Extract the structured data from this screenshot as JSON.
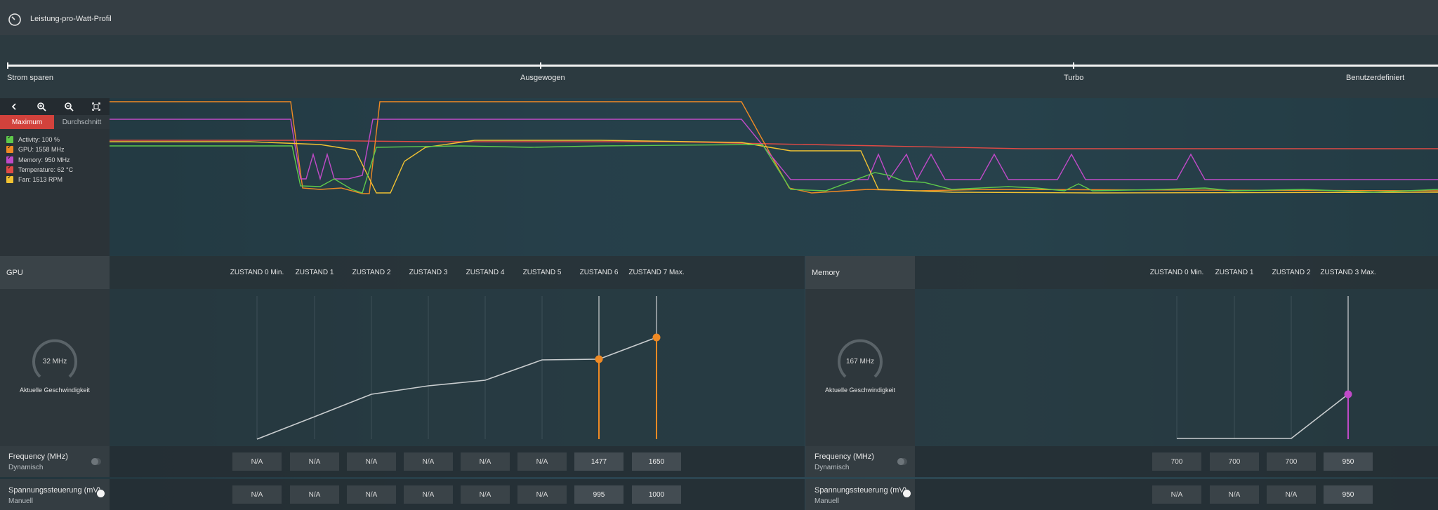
{
  "app": {
    "title": "Leistung-pro-Watt-Profil"
  },
  "profile_slider": {
    "options": [
      "Strom sparen",
      "Ausgewogen",
      "Turbo",
      "Benutzerdefiniert"
    ]
  },
  "graph": {
    "buttons": {
      "maximum": "Maximum",
      "average": "Durchschnitt"
    },
    "legend": [
      {
        "label": "Activity: 100 %",
        "color": "#5ec94b"
      },
      {
        "label": "GPU: 1558 MHz",
        "color": "#f08a24"
      },
      {
        "label": "Memory: 950 MHz",
        "color": "#c04ac8"
      },
      {
        "label": "Temperature: 62 °C",
        "color": "#e04a45"
      },
      {
        "label": "Fan: 1513 RPM",
        "color": "#f1c232"
      }
    ]
  },
  "gpu": {
    "title": "GPU",
    "states": [
      "ZUSTAND 0 Min.",
      "ZUSTAND 1",
      "ZUSTAND 2",
      "ZUSTAND 3",
      "ZUSTAND 4",
      "ZUSTAND 5",
      "ZUSTAND 6",
      "ZUSTAND 7 Max."
    ],
    "current_speed": "32 MHz",
    "current_speed_label": "Aktuelle Geschwindigkeit",
    "frequency": {
      "label": "Frequency (MHz)",
      "mode": "Dynamisch",
      "values": [
        "N/A",
        "N/A",
        "N/A",
        "N/A",
        "N/A",
        "N/A",
        "1477",
        "1650"
      ]
    },
    "voltage": {
      "label": "Spannungssteuerung (mV)",
      "mode": "Manuell",
      "values": [
        "N/A",
        "N/A",
        "N/A",
        "N/A",
        "N/A",
        "N/A",
        "995",
        "1000"
      ]
    }
  },
  "memory": {
    "title": "Memory",
    "states": [
      "ZUSTAND 0 Min.",
      "ZUSTAND 1",
      "ZUSTAND 2",
      "ZUSTAND 3 Max."
    ],
    "current_speed": "167 MHz",
    "current_speed_label": "Aktuelle Geschwindigkeit",
    "frequency": {
      "label": "Frequency (MHz)",
      "mode": "Dynamisch",
      "values": [
        "700",
        "700",
        "700",
        "950"
      ]
    },
    "voltage": {
      "label": "Spannungssteuerung (mV)",
      "mode": "Manuell",
      "values": [
        "N/A",
        "N/A",
        "N/A",
        "950"
      ]
    }
  },
  "colors": {
    "accent": "#d2423c",
    "gpu_point": "#f08a24",
    "memory_point": "#c04ac8"
  }
}
